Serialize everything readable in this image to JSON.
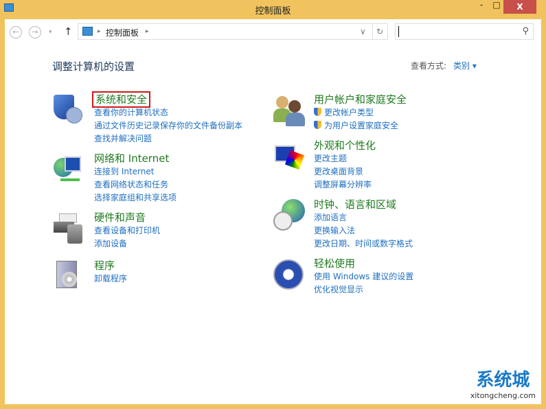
{
  "window": {
    "title": "控制面板",
    "minimize": "-",
    "maximize": "□",
    "close": "X"
  },
  "toolbar": {
    "back": "←",
    "forward": "→",
    "recent": "▾",
    "up": "↑",
    "breadcrumb": "控制面板",
    "sep": "▸",
    "dropdown": "∨",
    "refresh": "↻",
    "search_placeholder": "",
    "search_icon": "⚲"
  },
  "main": {
    "heading": "调整计算机的设置",
    "view_label": "查看方式:",
    "view_value": "类别 ▾"
  },
  "left": [
    {
      "title": "系统和安全",
      "icon": "shield-chart-icon",
      "links": [
        "查看你的计算机状态",
        "通过文件历史记录保存你的文件备份副本",
        "查找并解决问题"
      ]
    },
    {
      "title": "网络和 Internet",
      "icon": "globe-network-icon",
      "links": [
        "连接到 Internet",
        "查看网络状态和任务",
        "选择家庭组和共享选项"
      ]
    },
    {
      "title": "硬件和声音",
      "icon": "printer-speaker-icon",
      "links": [
        "查看设备和打印机",
        "添加设备"
      ]
    },
    {
      "title": "程序",
      "icon": "programs-box-icon",
      "links": [
        "卸载程序"
      ]
    }
  ],
  "right": [
    {
      "title": "用户帐户和家庭安全",
      "icon": "users-icon",
      "links": [
        "更改帐户类型",
        "为用户设置家庭安全"
      ]
    },
    {
      "title": "外观和个性化",
      "icon": "monitor-palette-icon",
      "links": [
        "更改主题",
        "更改桌面背景",
        "调整屏幕分辨率"
      ]
    },
    {
      "title": "时钟、语言和区域",
      "icon": "clock-globe-icon",
      "links": [
        "添加语言",
        "更换输入法",
        "更改日期、时间或数字格式"
      ]
    },
    {
      "title": "轻松使用",
      "icon": "ease-of-access-icon",
      "links": [
        "使用 Windows 建议的设置",
        "优化视觉显示"
      ]
    }
  ],
  "watermark": {
    "name": "系统城",
    "url": "xitongcheng.com"
  }
}
